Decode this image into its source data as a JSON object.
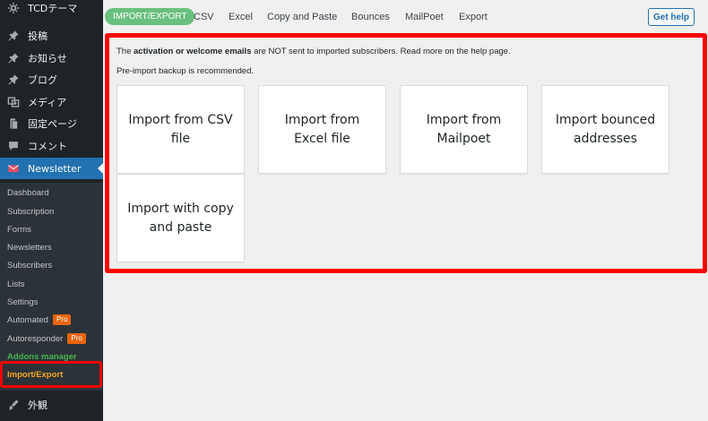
{
  "sidebar": {
    "top_items": [
      {
        "label": "TCDテーマ",
        "icon": "gear-icon"
      },
      {
        "label": "投稿",
        "icon": "pin-icon"
      },
      {
        "label": "お知らせ",
        "icon": "pin-icon"
      },
      {
        "label": "ブログ",
        "icon": "pin-icon"
      },
      {
        "label": "メディア",
        "icon": "media-icon"
      },
      {
        "label": "固定ページ",
        "icon": "page-icon"
      },
      {
        "label": "コメント",
        "icon": "comment-icon"
      }
    ],
    "newsletter": {
      "label": "Newsletter",
      "icon": "newsletter-icon"
    },
    "submenu": [
      {
        "label": "Dashboard"
      },
      {
        "label": "Subscription"
      },
      {
        "label": "Forms"
      },
      {
        "label": "Newsletters"
      },
      {
        "label": "Subscribers"
      },
      {
        "label": "Lists"
      },
      {
        "label": "Settings"
      },
      {
        "label": "Automated",
        "badge": "Pro"
      },
      {
        "label": "Autoresponder",
        "badge": "Pro"
      },
      {
        "label": "Addons manager"
      },
      {
        "label": "Import/Export"
      }
    ],
    "bottom_item": {
      "label": "外観",
      "icon": "brush-icon"
    }
  },
  "tabs": [
    {
      "label": "IMPORT/EXPORT",
      "active": true
    },
    {
      "label": "CSV"
    },
    {
      "label": "Excel"
    },
    {
      "label": "Copy and Paste"
    },
    {
      "label": "Bounces"
    },
    {
      "label": "MailPoet"
    },
    {
      "label": "Export"
    }
  ],
  "help_button": "Get help",
  "notice": {
    "prefix": "The ",
    "bold": "activation or welcome emails",
    "suffix": " are NOT sent to imported subscribers. Read more on the help page.",
    "backup": "Pre-import backup is recommended."
  },
  "cards": [
    {
      "label": "Import from CSV file"
    },
    {
      "label": "Import from Excel file"
    },
    {
      "label": "Import from Mailpoet"
    },
    {
      "label": "Import bounced addresses"
    },
    {
      "label": "Import with copy and paste"
    }
  ],
  "colors": {
    "sidebar_bg": "#1d2327",
    "submenu_bg": "#2c3338",
    "active_menu": "#2271b1",
    "active_tab": "#6ac07e",
    "highlight": "#ff0000",
    "pro_badge": "#e8650a",
    "addons": "#46b450",
    "import_export": "#f6a623"
  }
}
